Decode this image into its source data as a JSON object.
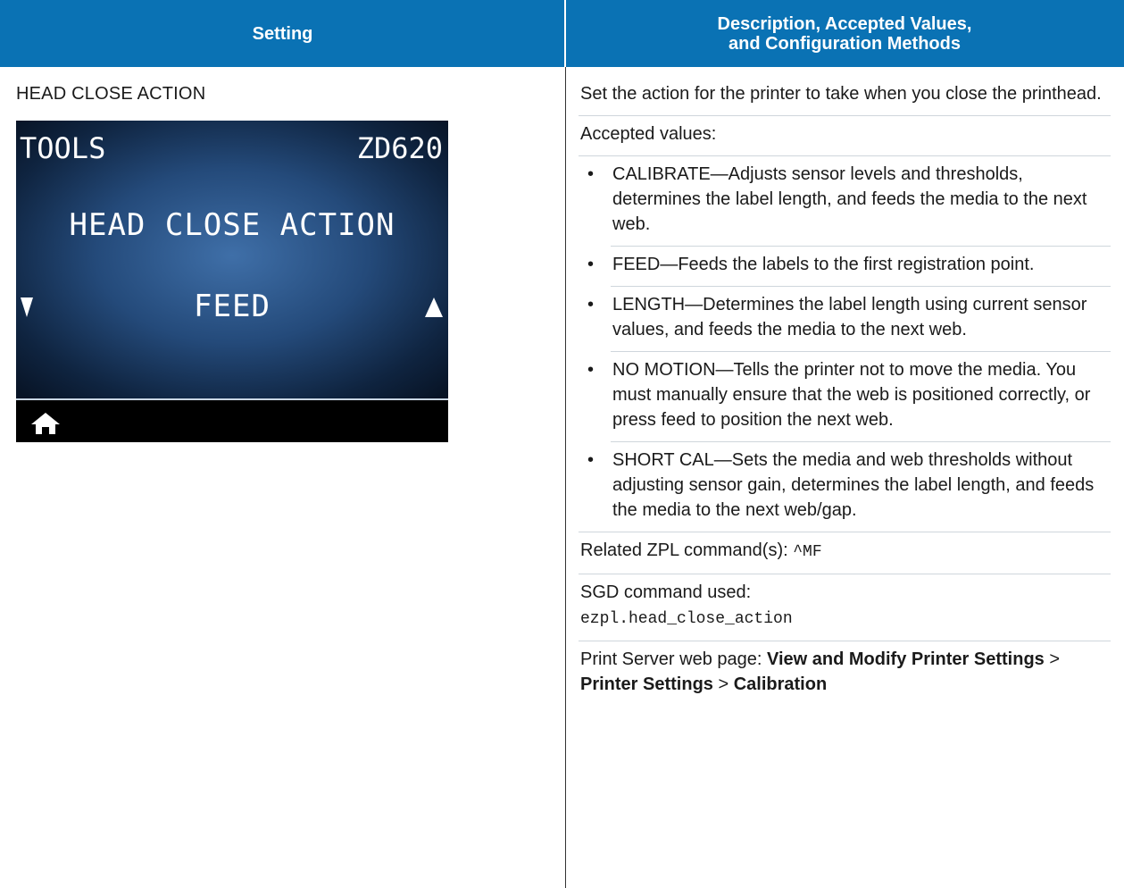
{
  "header": {
    "col1": "Setting",
    "col2_line1": "Description, Accepted Values,",
    "col2_line2": "and Configuration Methods"
  },
  "setting": {
    "name": "HEAD CLOSE ACTION",
    "screen": {
      "menu": "TOOLS",
      "model": "ZD620",
      "title": "HEAD CLOSE ACTION",
      "value": "FEED",
      "icons": [
        "down-arrow-icon",
        "up-arrow-icon",
        "home-icon"
      ]
    }
  },
  "description": {
    "intro": "Set the action for the printer to take when you close the printhead.",
    "accepted_label": "Accepted values:",
    "values": [
      "CALIBRATE—Adjusts sensor levels and thresholds, determines the label length, and feeds the media to the next web.",
      "FEED—Feeds the labels to the first registration point.",
      "LENGTH—Determines the label length using current sensor values, and feeds the media to the next web.",
      "NO MOTION—Tells the printer not to move the media. You must manually ensure that the web is positioned correctly, or press feed to position the next web.",
      "SHORT CAL—Sets the media and web thresholds without adjusting sensor gain, determines the label length, and feeds the media to the next web/gap."
    ],
    "zpl_label": "Related ZPL command(s): ",
    "zpl_command": "^MF",
    "sgd_label": "SGD command used:",
    "sgd_command": "ezpl.head_close_action",
    "web_label": "Print Server web page: ",
    "web_path_1": "View and Modify Printer Settings",
    "web_sep_1": " > ",
    "web_path_2": "Printer Settings",
    "web_sep_2": " > ",
    "web_path_3": "Calibration"
  }
}
